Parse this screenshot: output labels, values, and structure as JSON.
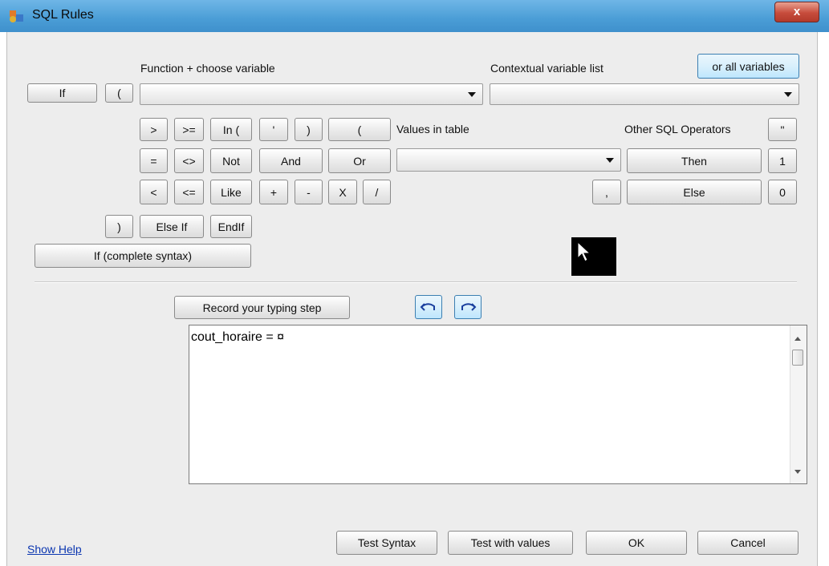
{
  "window": {
    "title": "SQL Rules",
    "close_label": "x"
  },
  "labels": {
    "function_choose": "Function + choose variable",
    "contextual_list": "Contextual variable list",
    "values_in_table": "Values in table",
    "other_sql_operators": "Other SQL Operators"
  },
  "buttons": {
    "all_variables": "or all variables",
    "if": "If",
    "open_paren": "(",
    "gt": ">",
    "gte": ">=",
    "in": "In (",
    "quote": "'",
    "close_paren": ")",
    "open_paren_wide": "(",
    "double_quote": "\"",
    "eq": "=",
    "neq": "<>",
    "not": "Not",
    "and": "And",
    "or": "Or",
    "then": "Then",
    "one": "1",
    "lt": "<",
    "lte": "<=",
    "like": "Like",
    "plus": "+",
    "minus": "-",
    "times": "X",
    "divide": "/",
    "comma": ",",
    "else": "Else",
    "zero": "0",
    "close_paren_2": ")",
    "else_if": "Else If",
    "endif": "EndIf",
    "if_complete": "If (complete syntax)",
    "record_typing": "Record your typing step",
    "test_syntax": "Test Syntax",
    "test_values": "Test with values",
    "ok": "OK",
    "cancel": "Cancel"
  },
  "combos": {
    "function_value": "",
    "contextual_value": "",
    "values_table_value": ""
  },
  "editor": {
    "text": "cout_horaire = ¤"
  },
  "footer": {
    "show_help": "Show Help"
  }
}
